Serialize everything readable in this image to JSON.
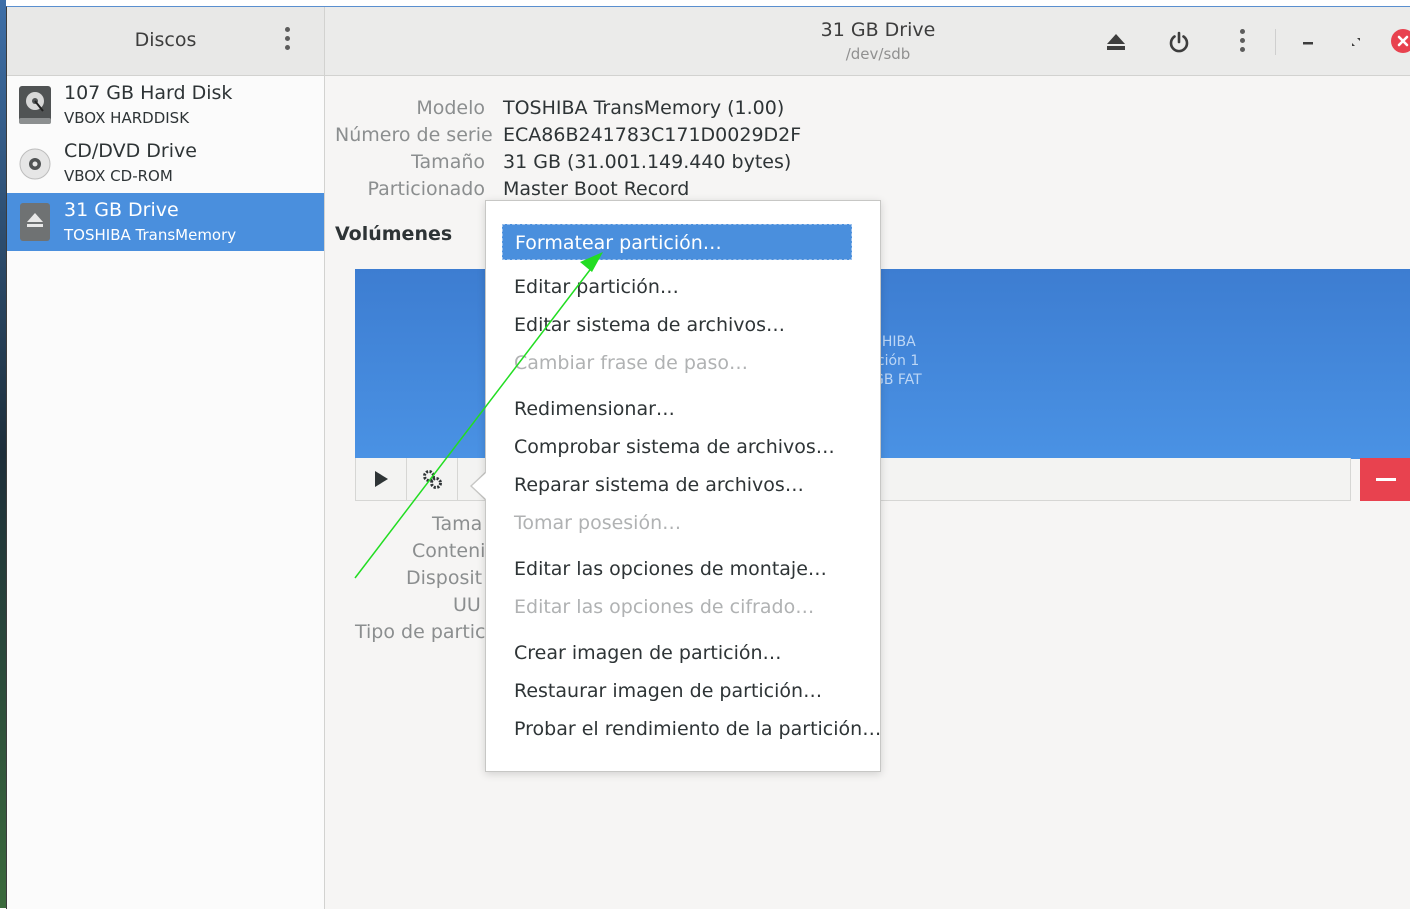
{
  "sidebar": {
    "title": "Discos",
    "drives": [
      {
        "name": "107 GB Hard Disk",
        "model": "VBOX HARDDISK",
        "icon": "hard-disk-icon",
        "selected": false
      },
      {
        "name": "CD/DVD Drive",
        "model": "VBOX CD-ROM",
        "icon": "optical-drive-icon",
        "selected": false
      },
      {
        "name": "31 GB Drive",
        "model": "TOSHIBA TransMemory",
        "icon": "usb-drive-icon",
        "selected": true
      }
    ]
  },
  "header": {
    "title": "31 GB Drive",
    "subtitle": "/dev/sdb",
    "buttons": [
      "eject-icon",
      "power-icon",
      "menu-dots-icon",
      "minimize-icon",
      "maximize-icon",
      "close-icon"
    ]
  },
  "drive_info": {
    "rows": [
      {
        "label": "Modelo",
        "value": "TOSHIBA TransMemory (1.00)"
      },
      {
        "label": "Número de serie",
        "value": "ECA86B241783C171D0029D2F"
      },
      {
        "label": "Tamaño",
        "value": "31 GB (31.001.149.440 bytes)"
      },
      {
        "label": "Particionado",
        "value": "Master Boot Record"
      }
    ]
  },
  "volumes": {
    "heading": "Volúmenes",
    "partition_label_partial": "SHIBA\nición 1\nGB FAT"
  },
  "volume_details": {
    "labels_partial": [
      "Tama",
      "Conteni",
      "Disposit",
      "UU",
      "Tipo de partici"
    ]
  },
  "menu": {
    "items": [
      {
        "label": "Formatear partición…",
        "state": "active"
      },
      {
        "label": "Editar partición…",
        "state": "enabled"
      },
      {
        "label": "Editar sistema de archivos…",
        "state": "enabled"
      },
      {
        "label": "Cambiar frase de paso…",
        "state": "disabled"
      },
      {
        "label": "Redimensionar…",
        "state": "enabled"
      },
      {
        "label": "Comprobar sistema de archivos…",
        "state": "enabled"
      },
      {
        "label": "Reparar sistema de archivos…",
        "state": "enabled"
      },
      {
        "label": "Tomar posesión…",
        "state": "disabled"
      },
      {
        "label": "Editar las opciones de montaje…",
        "state": "enabled"
      },
      {
        "label": "Editar las opciones de cifrado…",
        "state": "disabled"
      },
      {
        "label": "Crear imagen de partición…",
        "state": "enabled"
      },
      {
        "label": "Restaurar imagen de partición…",
        "state": "enabled"
      },
      {
        "label": "Probar el rendimiento de la partición…",
        "state": "enabled"
      }
    ]
  },
  "colors": {
    "accent": "#4a8fdd",
    "destructive": "#e8424f",
    "annotation_arrow": "#22dd22"
  }
}
